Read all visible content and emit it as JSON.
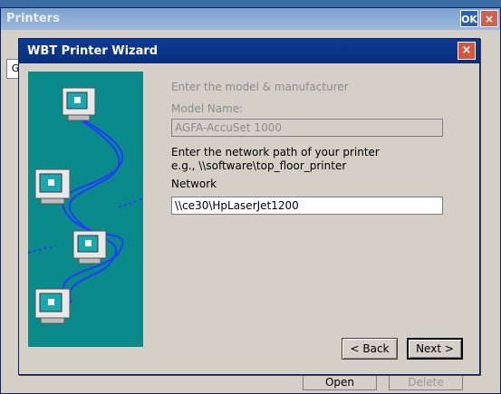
{
  "background_window": {
    "title": "Printers",
    "ok_label": "OK",
    "close_symbol": "×",
    "tab_label": "G",
    "open_label": "Open",
    "delete_label": "Delete"
  },
  "dialog": {
    "title": "WBT Printer Wizard",
    "close_symbol": "×",
    "model_heading": "Enter the model & manufacturer",
    "model_name_label": "Model Name:",
    "model_name_value": "AGFA-AccuSet 1000",
    "network_instruction": "Enter the network path of your printer",
    "network_example": "e.g., \\\\software\\top_floor_printer",
    "network_label": "Network",
    "network_value": "\\\\ce30\\HpLaserJet1200",
    "back_label": "< Back",
    "next_label": "Next >"
  },
  "colors": {
    "titlebar": "#0a2f7a",
    "art_background": "#0a8a8a",
    "cable": "#1f3cff"
  }
}
